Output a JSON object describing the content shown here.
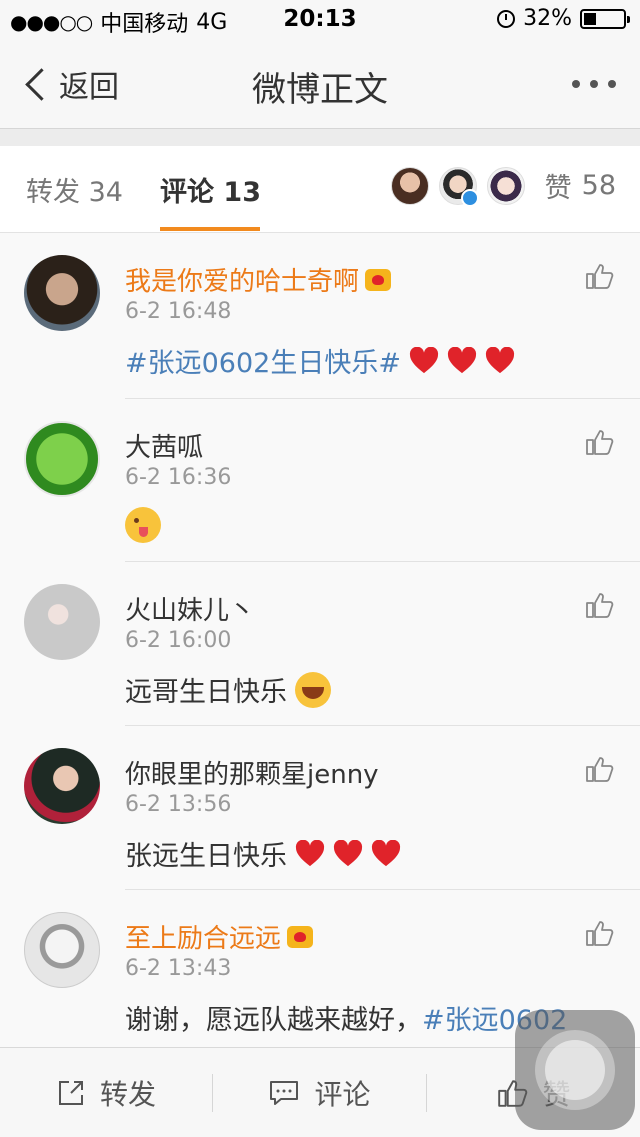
{
  "status_bar": {
    "carrier": "中国移动",
    "network": "4G",
    "time": "20:13",
    "battery": "32%",
    "battery_level": 0.32,
    "signal_bars": 3
  },
  "nav": {
    "back_label": "返回",
    "title": "微博正文"
  },
  "tabs": {
    "repost_label": "转发",
    "repost_count": "34",
    "comment_label": "评论",
    "comment_count": "13",
    "like_label": "赞",
    "like_count": "58"
  },
  "comments": [
    {
      "name": "我是你爱的哈士奇啊",
      "vip": true,
      "time": "6-2 16:48",
      "hashtag": "#张远0602生日快乐#",
      "text": "",
      "emojis": [
        "heart",
        "heart",
        "heart"
      ]
    },
    {
      "name": "大茜呱",
      "vip": false,
      "time": "6-2 16:36",
      "hashtag": "",
      "text": "",
      "emojis": [
        "tongue-face"
      ]
    },
    {
      "name": "火山妹儿丶",
      "vip": false,
      "time": "6-2 16:00",
      "hashtag": "",
      "text": "远哥生日快乐",
      "emojis": [
        "laugh-face"
      ]
    },
    {
      "name": "你眼里的那颗星jenny",
      "vip": false,
      "time": "6-2 13:56",
      "hashtag": "",
      "text": "张远生日快乐",
      "emojis": [
        "heart",
        "heart",
        "heart"
      ]
    },
    {
      "name": "至上励合远远",
      "vip": true,
      "time": "6-2 13:43",
      "text": "谢谢，愿远队越来越好，",
      "hashtag": "#张远0602"
    }
  ],
  "bottom_bar": {
    "repost_label": "转发",
    "comment_label": "评论",
    "like_label": "赞"
  },
  "colors": {
    "accent_orange": "#ec7a18",
    "tab_underline": "#f28a1e",
    "hashtag_blue": "#4a7fb8",
    "heart_red": "#e0232a"
  }
}
